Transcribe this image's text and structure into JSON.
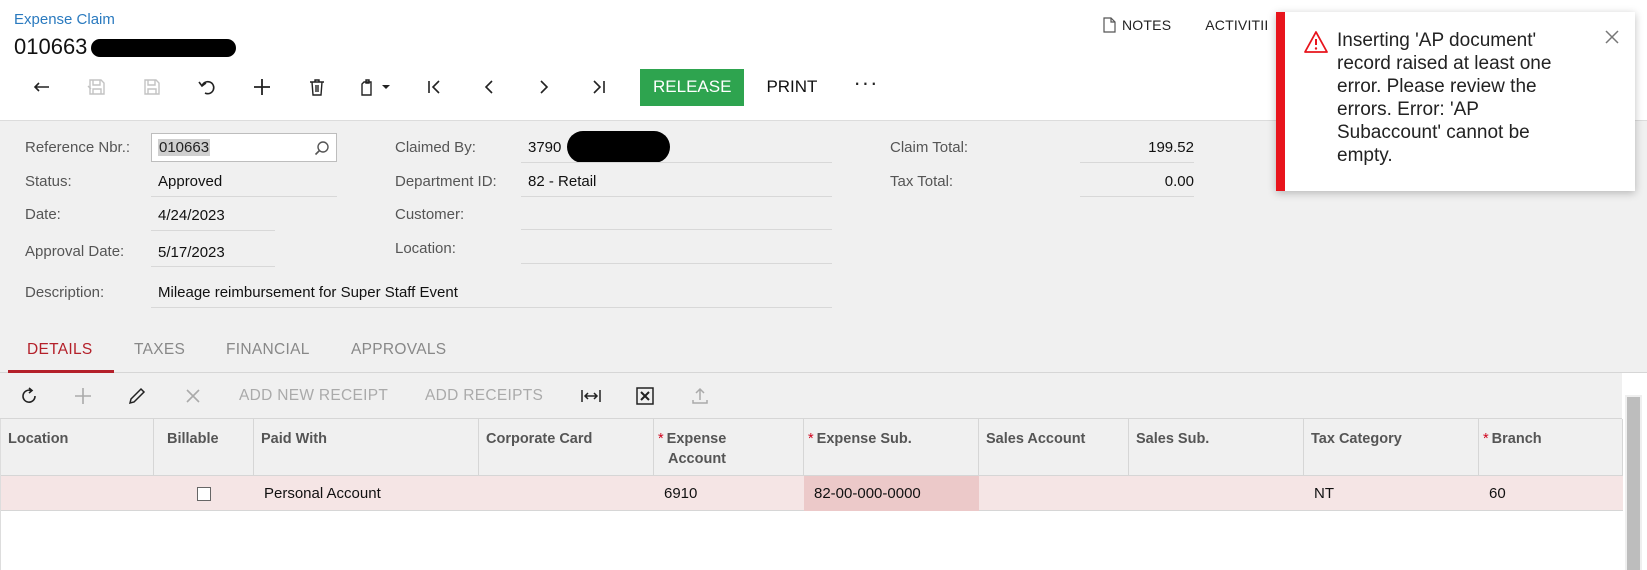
{
  "header": {
    "screen_title": "Expense Claim",
    "record_number": "010663"
  },
  "top_links": {
    "notes": "NOTES",
    "activities": "ACTIVITII"
  },
  "toolbar": {
    "buttons": [
      "back-icon",
      "save-close-icon",
      "save-icon",
      "undo-icon",
      "add-icon",
      "delete-icon",
      "copy-paste-icon",
      "first-icon",
      "previous-icon",
      "next-icon",
      "last-icon"
    ],
    "release_label": "RELEASE",
    "print_label": "PRINT",
    "more_label": "···",
    "release_color": "#2ea44f"
  },
  "form": {
    "reference_nbr": {
      "label": "Reference Nbr.:",
      "value": "010663"
    },
    "status": {
      "label": "Status:",
      "value": "Approved"
    },
    "date": {
      "label": "Date:",
      "value": "4/24/2023"
    },
    "approval_date": {
      "label": "Approval Date:",
      "value": "5/17/2023"
    },
    "description": {
      "label": "Description:",
      "value": "Mileage reimbursement for Super Staff Event"
    },
    "claimed_by": {
      "label": "Claimed By:",
      "value": "3790"
    },
    "department_id": {
      "label": "Department ID:",
      "value": "82 - Retail"
    },
    "customer": {
      "label": "Customer:",
      "value": ""
    },
    "location": {
      "label": "Location:",
      "value": ""
    },
    "claim_total": {
      "label": "Claim Total:",
      "value": "199.52"
    },
    "tax_total": {
      "label": "Tax Total:",
      "value": "0.00"
    }
  },
  "tabs": {
    "details": "DETAILS",
    "taxes": "TAXES",
    "financial": "FINANCIAL",
    "approvals": "APPROVALS",
    "active": "DETAILS",
    "active_color": "#b4202a"
  },
  "grid_toolbar": {
    "add_new_receipt": "ADD NEW RECEIPT",
    "add_receipts": "ADD RECEIPTS"
  },
  "grid": {
    "columns": {
      "location": "Location",
      "billable": "Billable",
      "paid_with": "Paid With",
      "corporate_card": "Corporate Card",
      "expense_account_1": "Expense",
      "expense_account_2": "Account",
      "expense_sub": "Expense Sub.",
      "sales_account": "Sales Account",
      "sales_sub": "Sales Sub.",
      "tax_category": "Tax Category",
      "branch": "Branch"
    },
    "required_mark": "*",
    "rows": [
      {
        "location": "",
        "billable": false,
        "paid_with": "Personal Account",
        "corporate_card": "",
        "expense_account": "6910",
        "expense_sub": "82-00-000-0000",
        "sales_account": "",
        "sales_sub": "",
        "tax_category": "NT",
        "branch": "60"
      }
    ]
  },
  "notification": {
    "message": "Inserting  'AP document' record raised at least one error. Please review the errors. Error: 'AP Subaccount' cannot be empty.",
    "type": "error",
    "accent_color": "#e8141c"
  }
}
